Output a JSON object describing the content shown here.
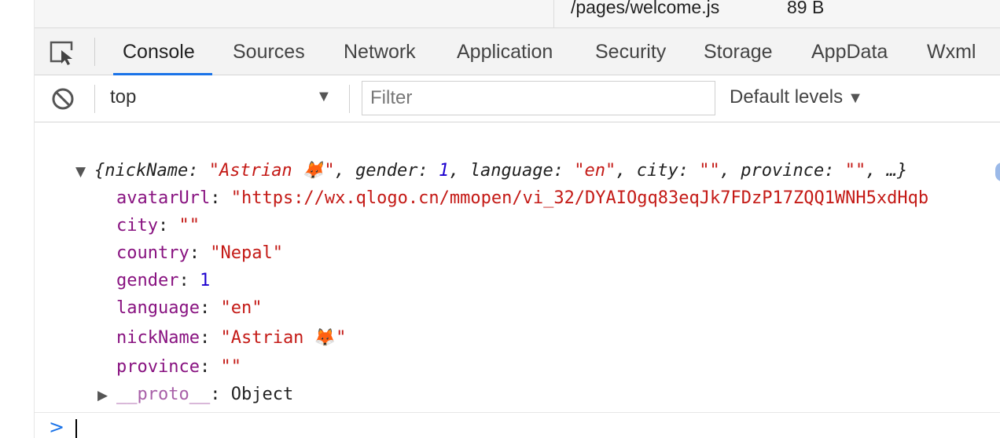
{
  "file_bar": {
    "file_name": "/pages/welcome.js",
    "file_size": "89 B"
  },
  "tabs": [
    {
      "label": "Console",
      "active": true
    },
    {
      "label": "Sources",
      "active": false
    },
    {
      "label": "Network",
      "active": false
    },
    {
      "label": "Application",
      "active": false
    },
    {
      "label": "Security",
      "active": false
    },
    {
      "label": "Storage",
      "active": false
    },
    {
      "label": "AppData",
      "active": false
    },
    {
      "label": "Wxml",
      "active": false
    }
  ],
  "toolbar": {
    "context": "top",
    "filter_placeholder": "Filter",
    "filter_value": "",
    "levels": "Default levels"
  },
  "console": {
    "summary": {
      "open": "{",
      "pairs": [
        {
          "key": "nickName",
          "value": "\"Astrian 🦊\""
        },
        {
          "key": "gender",
          "value": "1"
        },
        {
          "key": "language",
          "value": "\"en\""
        },
        {
          "key": "city",
          "value": "\"\""
        },
        {
          "key": "province",
          "value": "\"\""
        }
      ],
      "ellipsis": "…}"
    },
    "properties": [
      {
        "key": "avatarUrl",
        "value": "\"https://wx.qlogo.cn/mmopen/vi_32/DYAIOgq83eqJk7FDzP17ZQQ1WNH5xdHqb"
      },
      {
        "key": "city",
        "value": "\"\""
      },
      {
        "key": "country",
        "value": "\"Nepal\""
      },
      {
        "key": "gender",
        "value": "1"
      },
      {
        "key": "language",
        "value": "\"en\""
      },
      {
        "key": "nickName",
        "value": "\"Astrian 🦊\""
      },
      {
        "key": "province",
        "value": "\"\""
      }
    ],
    "proto": {
      "key": "__proto__",
      "value": "Object"
    }
  },
  "prompt": {
    "symbol": ">"
  },
  "icons": {
    "inspect": "inspect-element-icon",
    "clear": "clear-console-icon",
    "expand": "expand-triangle-icon",
    "collapse": "collapse-triangle-icon",
    "prompt": "prompt-chevron-icon"
  },
  "colors": {
    "accent": "#1a73e8",
    "string": "#c41a16",
    "number": "#1c00cf",
    "key": "#881280"
  }
}
